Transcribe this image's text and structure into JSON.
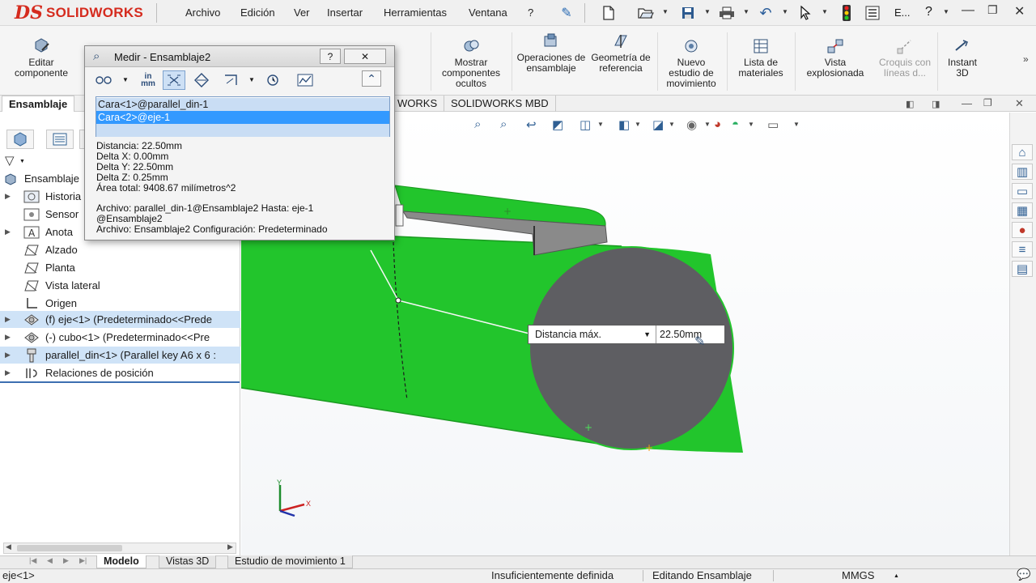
{
  "app": {
    "logo_ds": "DS",
    "logo_text": "SOLIDWORKS",
    "menu": [
      "Archivo",
      "Edición",
      "Ver",
      "Insertar",
      "Herramientas",
      "Ventana",
      "?"
    ],
    "search_label": "E...",
    "help": "?"
  },
  "commands": [
    {
      "label": "Editar componente",
      "icon": "edit-component-icon",
      "enabled": true
    },
    {
      "label": "Mostrar componentes ocultos",
      "icon": "show-hidden-icon",
      "enabled": true
    },
    {
      "label": "Operaciones de ensamblaje",
      "icon": "assembly-features-icon",
      "enabled": true
    },
    {
      "label": "Geometría de referencia",
      "icon": "reference-geometry-icon",
      "enabled": true
    },
    {
      "label": "Nuevo estudio de movimiento",
      "icon": "motion-study-icon",
      "enabled": true
    },
    {
      "label": "Lista de materiales",
      "icon": "bom-icon",
      "enabled": true
    },
    {
      "label": "Vista explosionada",
      "icon": "exploded-view-icon",
      "enabled": true
    },
    {
      "label": "Croquis con líneas d...",
      "icon": "explode-line-sketch-icon",
      "enabled": false
    },
    {
      "label": "Instant 3D",
      "icon": "instant3d-icon",
      "enabled": true
    }
  ],
  "cm_tabs": [
    {
      "label": "Ensamblaje",
      "active": true
    },
    {
      "label": "WORKS",
      "active": false
    },
    {
      "label": "SOLIDWORKS MBD",
      "active": false
    }
  ],
  "tree": [
    {
      "label": "Ensamblaje",
      "icon": "assembly-icon",
      "expander": false,
      "selected": false
    },
    {
      "label": "Historia",
      "icon": "history-icon",
      "expander": true,
      "selected": false
    },
    {
      "label": "Sensor",
      "icon": "sensor-icon",
      "expander": false,
      "selected": false
    },
    {
      "label": "Anota",
      "icon": "annotation-icon",
      "expander": true,
      "selected": false
    },
    {
      "label": "Alzado",
      "icon": "plane-icon",
      "expander": false,
      "selected": false
    },
    {
      "label": "Planta",
      "icon": "plane-icon",
      "expander": false,
      "selected": false
    },
    {
      "label": "Vista lateral",
      "icon": "plane-icon",
      "expander": false,
      "selected": false
    },
    {
      "label": "Origen",
      "icon": "origin-icon",
      "expander": false,
      "selected": false
    },
    {
      "label": "(f) eje<1> (Predeterminado<<Prede",
      "icon": "part-icon",
      "expander": true,
      "selected": true
    },
    {
      "label": "(-) cubo<1> (Predeterminado<<Pre",
      "icon": "part-icon",
      "expander": true,
      "selected": false
    },
    {
      "label": "parallel_din<1> (Parallel key A6 x 6 :",
      "icon": "key-part-icon",
      "expander": true,
      "selected": true
    },
    {
      "label": "Relaciones de posición",
      "icon": "mates-icon",
      "expander": true,
      "selected": false
    }
  ],
  "measure": {
    "title": "Medir - Ensamblaje2",
    "help_btn": "?",
    "close_btn": "✕",
    "units_label": "in\nmm",
    "selections": [
      "Cara<1>@parallel_din-1",
      "Cara<2>@eje-1"
    ],
    "results": [
      "Distancia: 22.50mm",
      "Delta X: 0.00mm",
      "Delta Y: 22.50mm",
      "Delta Z: 0.25mm",
      "Área total: 9408.67 milímetros^2"
    ],
    "file_info": [
      "Archivo: parallel_din-1@Ensamblaje2 Hasta: eje-1",
      "@Ensamblaje2",
      "Archivo: Ensamblaje2 Configuración: Predeterminado"
    ]
  },
  "dimension": {
    "label": "Distancia máx.",
    "value": "22.50mm"
  },
  "triad": {
    "y": "Y",
    "x": "X"
  },
  "bottom_tabs": [
    {
      "label": "Modelo",
      "active": true
    },
    {
      "label": "Vistas 3D",
      "active": false
    },
    {
      "label": "Estudio de movimiento 1",
      "active": false
    }
  ],
  "status": {
    "selected": "eje<1>",
    "definition": "Insuficientemente definida",
    "mode": "Editando Ensamblaje",
    "units": "MMGS"
  },
  "colors": {
    "part_green": "#22c52c",
    "face_grey": "#5e5e62",
    "accent": "#d52b1e",
    "selection_blue": "#3399ff"
  }
}
